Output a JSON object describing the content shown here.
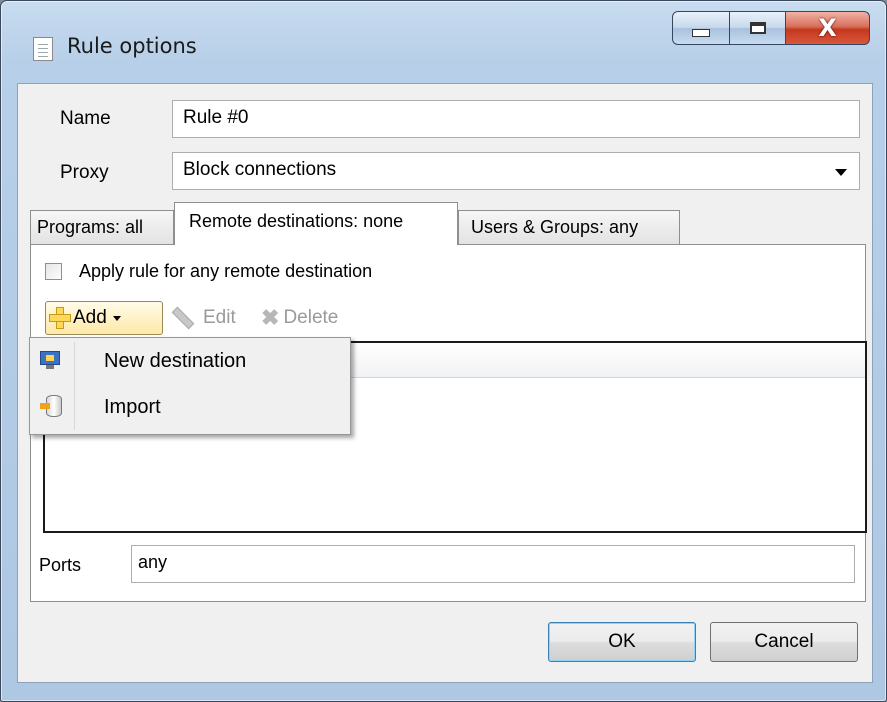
{
  "window": {
    "title": "Rule options",
    "caption": {
      "minimize_icon": "minimize-icon",
      "maximize_icon": "maximize-icon",
      "close_glyph": "X"
    }
  },
  "form": {
    "name_label": "Name",
    "name_value": "Rule #0",
    "proxy_label": "Proxy",
    "proxy_value": "Block connections"
  },
  "tabs": [
    {
      "label": "Programs: all",
      "active": false
    },
    {
      "label": "Remote destinations: none",
      "active": true
    },
    {
      "label": "Users & Groups: any",
      "active": false
    }
  ],
  "destinations": {
    "apply_any_label": "Apply rule for any remote destination",
    "apply_any_checked": false,
    "toolbar": {
      "add": "Add",
      "edit": "Edit",
      "delete": "Delete"
    },
    "add_menu": [
      {
        "label": "New destination",
        "icon": "monitor-icon"
      },
      {
        "label": "Import",
        "icon": "import-icon"
      }
    ],
    "ports_label": "Ports",
    "ports_value": "any"
  },
  "buttons": {
    "ok": "OK",
    "cancel": "Cancel"
  }
}
